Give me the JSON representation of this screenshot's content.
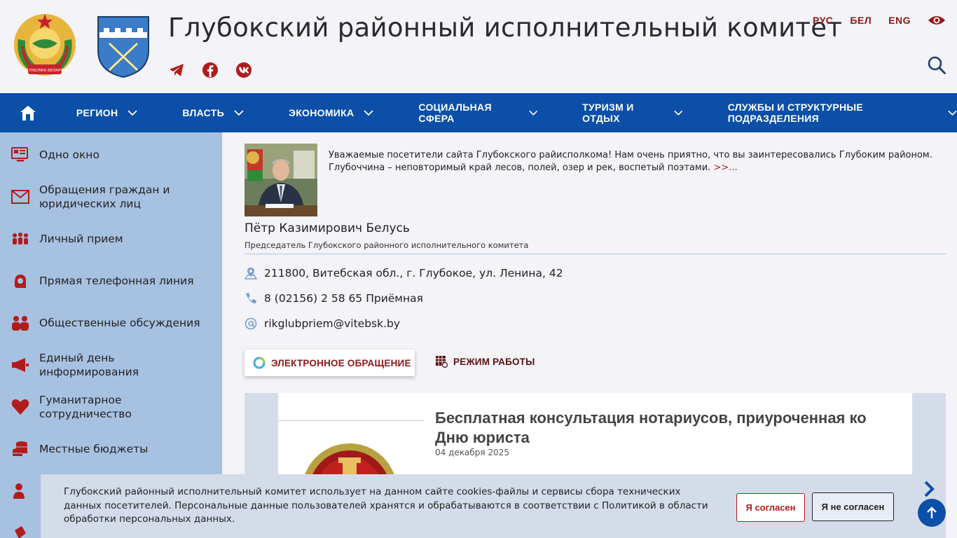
{
  "header": {
    "title": "Глубокский районный исполнительный комитет",
    "emblem_text": "РЭСПУБЛІКА БЕЛАРУСЬ",
    "socials": [
      "telegram-icon",
      "facebook-icon",
      "vk-icon"
    ],
    "languages": [
      "РУС",
      "БЕЛ",
      "ENG"
    ]
  },
  "nav": {
    "items": [
      "РЕГИОН",
      "ВЛАСТЬ",
      "ЭКОНОМИКА",
      "СОЦИАЛЬНАЯ СФЕРА",
      "ТУРИЗМ И ОТДЫХ",
      "СЛУЖБЫ И СТРУКТУРНЫЕ ПОДРАЗДЕЛЕНИЯ"
    ]
  },
  "sidebar": {
    "items": [
      {
        "label": "Одно окно",
        "icon": "monitor-icon"
      },
      {
        "label": "Обращения граждан и юридических лиц",
        "icon": "envelope-icon"
      },
      {
        "label": "Личный прием",
        "icon": "people-icon"
      },
      {
        "label": "Прямая телефонная линия",
        "icon": "headset-icon"
      },
      {
        "label": "Общественные обсуждения",
        "icon": "discussion-icon"
      },
      {
        "label": "Единый день информирования",
        "icon": "megaphone-icon"
      },
      {
        "label": "Гуманитарное сотрудничество",
        "icon": "heart-icon"
      },
      {
        "label": "Местные бюджеты",
        "icon": "coins-icon"
      }
    ]
  },
  "leader": {
    "greeting": "Уважаемые посетители сайта Глубокского райисполкома! Нам очень приятно, что вы заинтересовались Глубоким районом. Глубоччина – неповторимый край лесов, полей, озер и рек, воспетый поэтами.",
    "more": ">>...",
    "name": "Пётр Казимирович Белусь",
    "role": "Председатель Глубокского районного исполнительного комитета"
  },
  "contacts": {
    "address": "211800, Витебская обл., г. Глубокое, ул. Ленина, 42",
    "phone": "8 (02156) 2 58 65 Приёмная",
    "email": "rikglubpriem@vitebsk.by"
  },
  "actions": {
    "appeal": "ЭЛЕКТРОННОЕ ОБРАЩЕНИЕ",
    "hours": "РЕЖИМ РАБОТЫ"
  },
  "news": {
    "title": "Бесплатная консультация нотариусов, приуроченная ко Дню юриста",
    "date": "04 декабря 2025"
  },
  "cookie": {
    "text": "Глубокский районный исполнительный комитет использует на данном сайте cookies-файлы и сервисы сбора технических данных посетителей. Персональные данные пользователей хранятся и обрабатываются в соответствии с Политикой в области обработки персональных данных.",
    "agree": "Я согласен",
    "disagree": "Я не согласен"
  },
  "colors": {
    "nav_bg": "#0b4fa8",
    "sidebar_bg": "#a7c1e1",
    "accent_red": "#b01c1c",
    "lang_color": "#8b1a1a"
  }
}
